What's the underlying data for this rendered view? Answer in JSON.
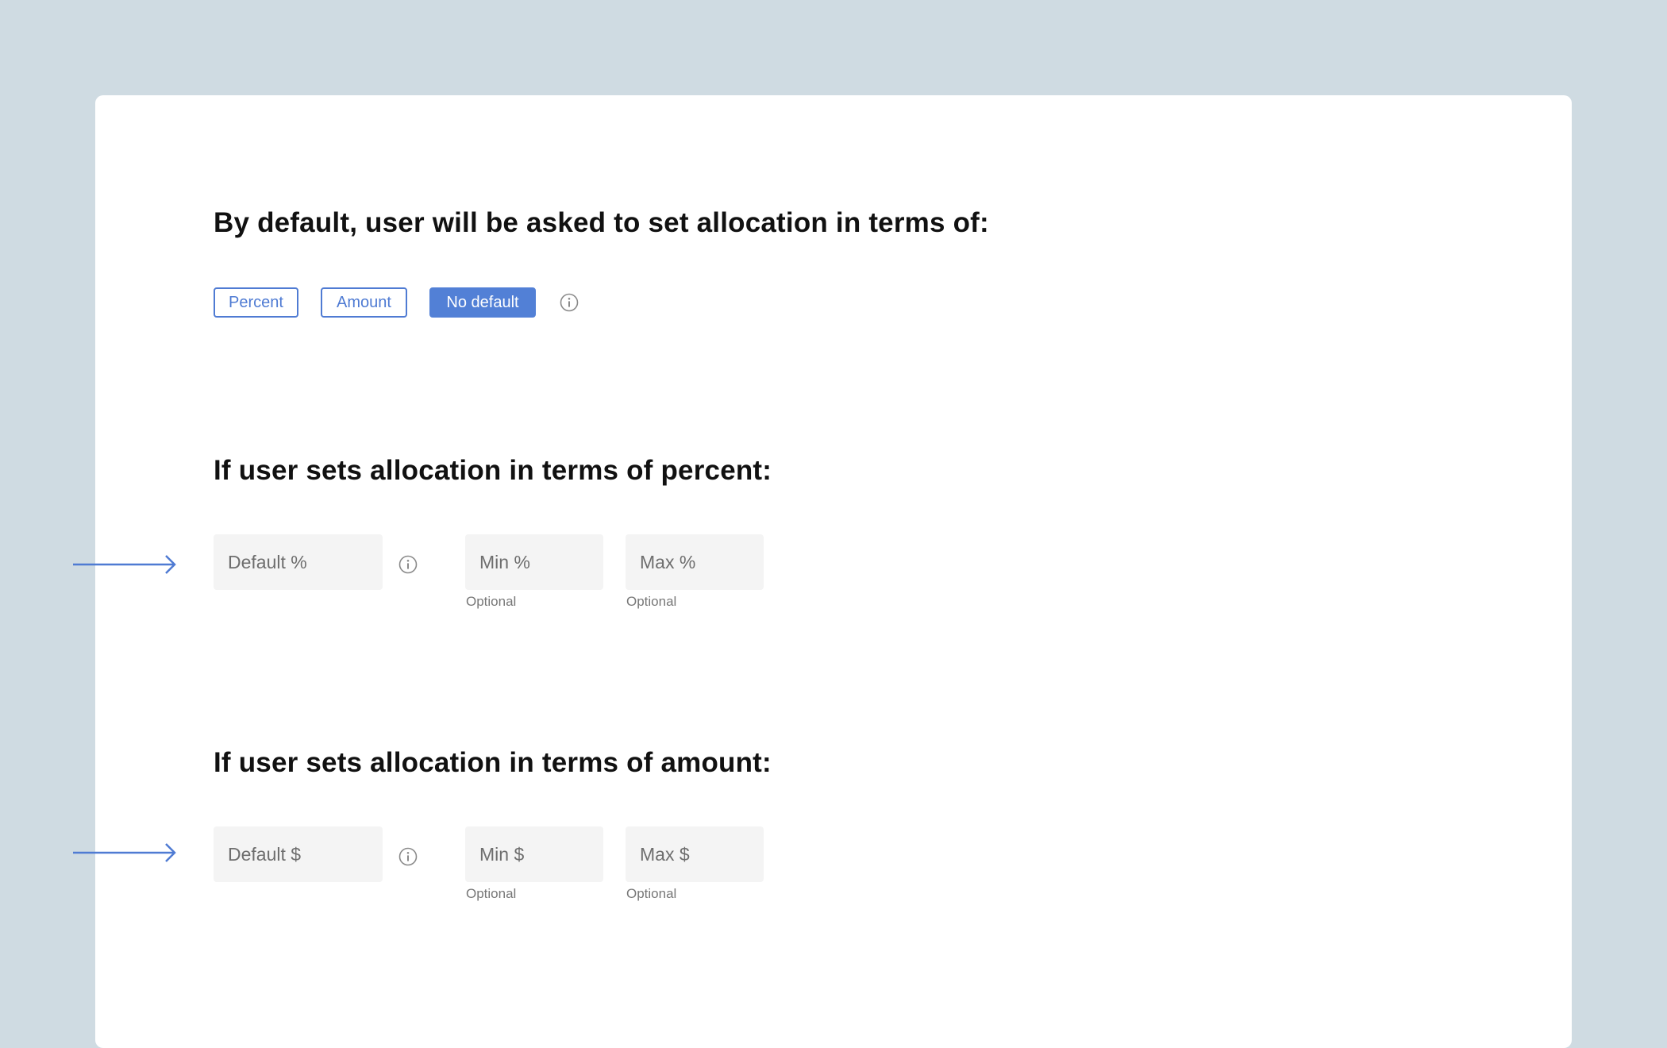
{
  "default_mode": {
    "heading": "By default, user will be asked to set allocation in terms of:",
    "options": [
      {
        "label": "Percent",
        "selected": false
      },
      {
        "label": "Amount",
        "selected": false
      },
      {
        "label": "No default",
        "selected": true
      }
    ],
    "info_icon": "info-circle-icon"
  },
  "percent_section": {
    "heading": "If user sets allocation in terms of percent:",
    "default_placeholder": "Default %",
    "min_placeholder": "Min %",
    "max_placeholder": "Max %",
    "min_hint": "Optional",
    "max_hint": "Optional",
    "info_icon": "info-circle-icon",
    "pointer_icon": "arrow-right-icon"
  },
  "amount_section": {
    "heading": "If user sets allocation in terms of amount:",
    "default_placeholder": "Default $",
    "min_placeholder": "Min $",
    "max_placeholder": "Max $",
    "min_hint": "Optional",
    "max_hint": "Optional",
    "info_icon": "info-circle-icon",
    "pointer_icon": "arrow-right-icon"
  },
  "colors": {
    "background": "#cfdbe2",
    "card": "#ffffff",
    "accent": "#5280d6",
    "field_bg": "#f4f4f4",
    "heading_text": "#111111",
    "hint_text": "#777777"
  }
}
